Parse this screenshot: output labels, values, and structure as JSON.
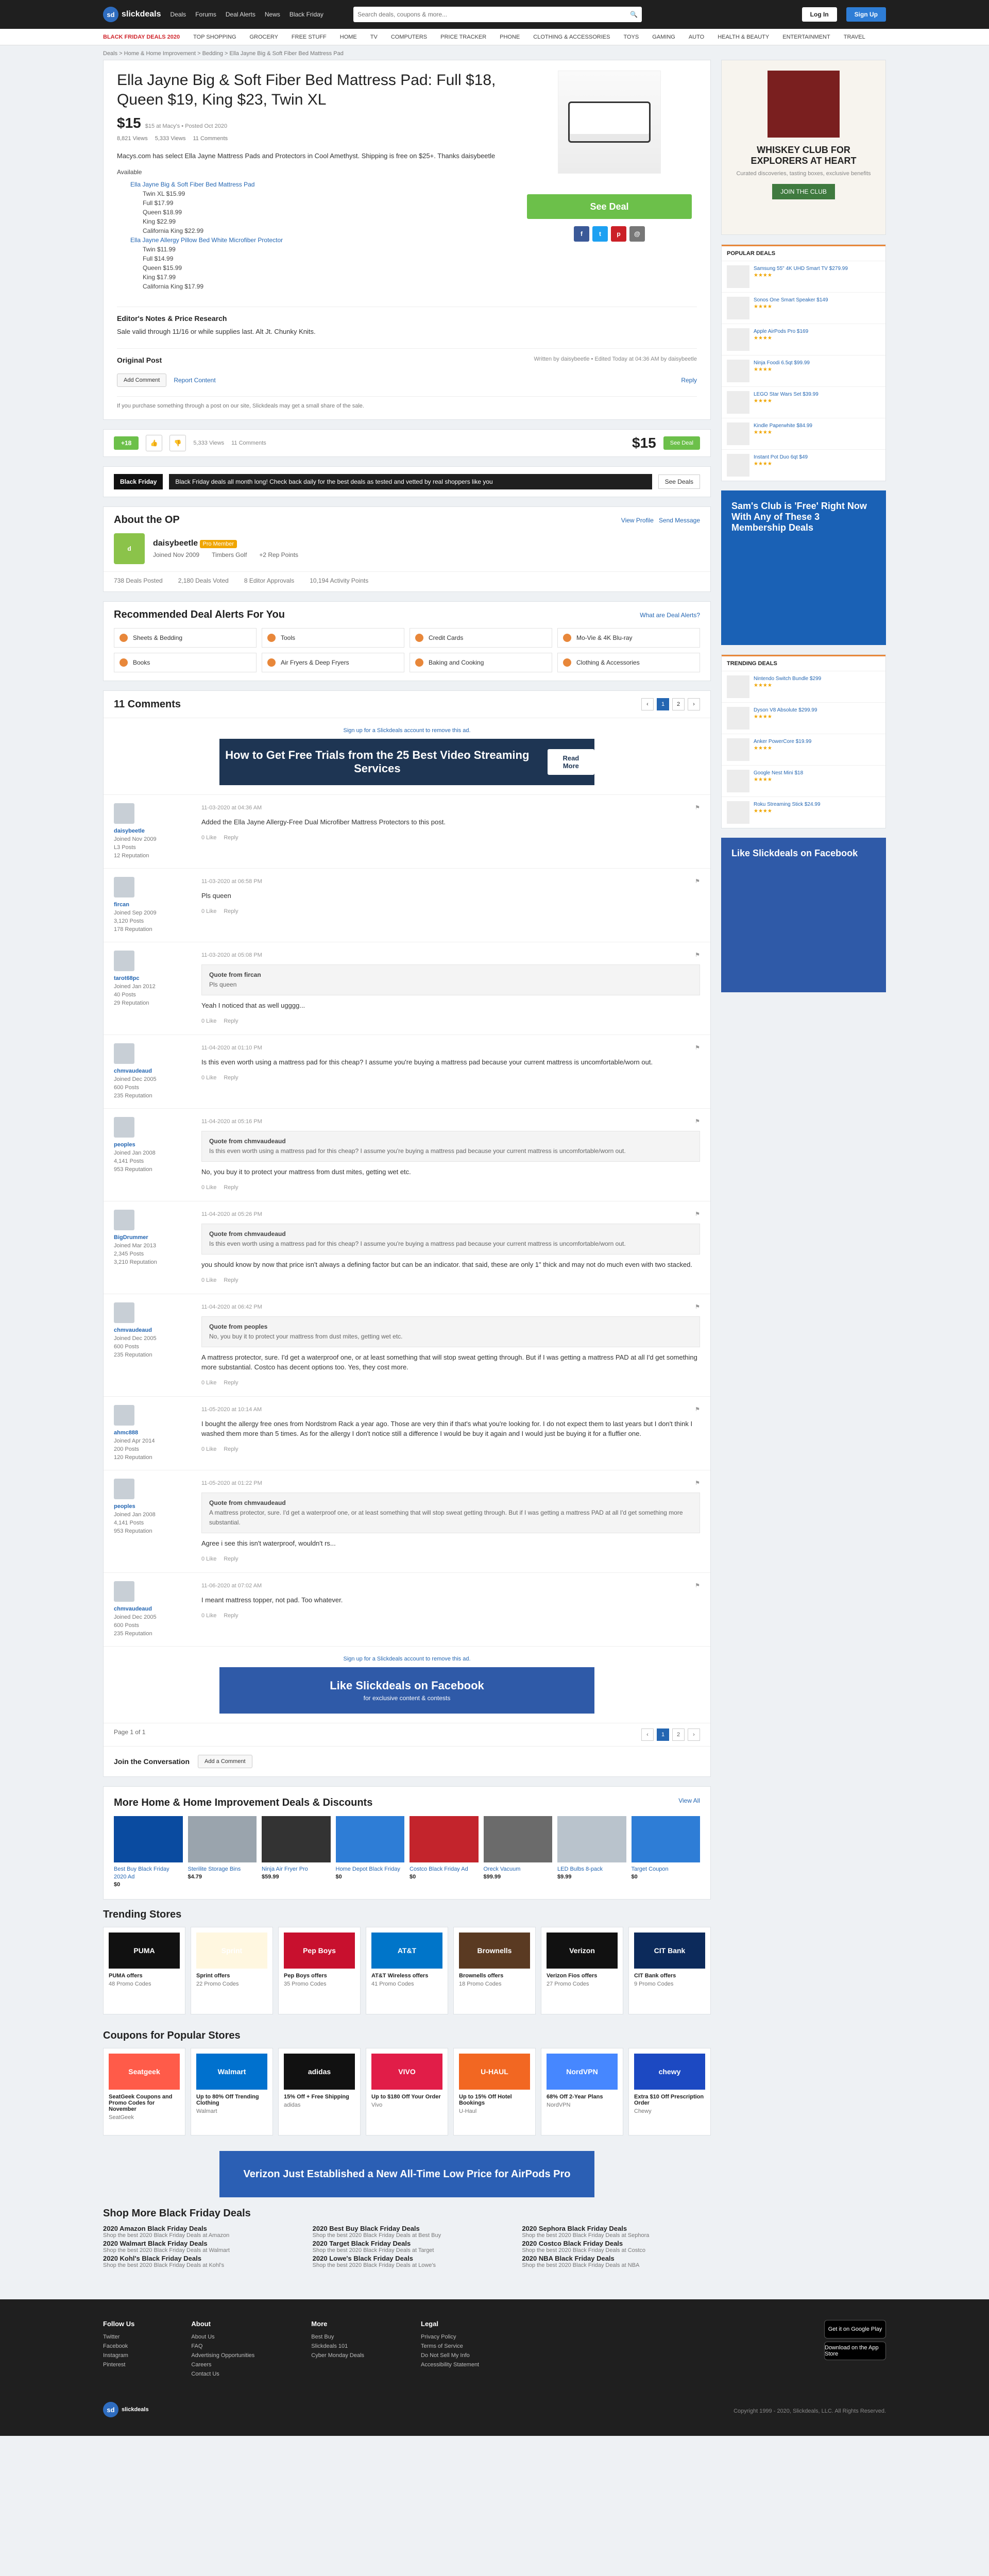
{
  "nav": {
    "logo": "slickdeals",
    "links": [
      "Deals",
      "Forums",
      "Deal Alerts",
      "News",
      "Black Friday"
    ],
    "search_placeholder": "Search deals, coupons & more...",
    "login": "Log In",
    "signup": "Sign Up"
  },
  "categories": [
    "BLACK FRIDAY DEALS 2020",
    "TOP SHOPPING",
    "GROCERY",
    "FREE STUFF",
    "HOME",
    "TV",
    "COMPUTERS",
    "PRICE TRACKER",
    "PHONE",
    "CLOTHING & ACCESSORIES",
    "TOYS",
    "GAMING",
    "AUTO",
    "HEALTH & BEAUTY",
    "ENTERTAINMENT",
    "TRAVEL"
  ],
  "breadcrumb": "Deals > Home & Home Improvement > Bedding > Ella Jayne Big & Soft Fiber Bed Mattress Pad",
  "deal": {
    "title": "Ella Jayne Big & Soft Fiber Bed Mattress Pad: Full $18, Queen $19, King $23, Twin XL",
    "price": "$15",
    "meta": "$15 at Macy's • Posted Oct 2020",
    "stats": [
      "8,821 Views",
      "5,333 Views",
      "11 Comments"
    ],
    "desc": "Macys.com has select Ella Jayne Mattress Pads and Protectors in Cool Amethyst. Shipping is free on $25+. Thanks daisybeetle",
    "available_label": "Available",
    "variants": [
      {
        "name": "Ella Jayne Big & Soft Fiber Bed Mattress Pad",
        "sizes": [
          "Twin XL $15.99",
          "Full $17.99",
          "Queen $18.99",
          "King $22.99",
          "California King $22.99"
        ]
      },
      {
        "name": "Ella Jayne Allergy Pillow Bed White Microfiber Protector",
        "sizes": [
          "Twin $11.99",
          "Full $14.99",
          "Queen $15.99",
          "King $17.99",
          "California King $17.99"
        ]
      }
    ],
    "get_deal": "See Deal",
    "editor_title": "Editor's Notes & Price Research",
    "editor_text": "Sale valid through 11/16 or while supplies last. Alt Jt. Chunky Knits.",
    "editor_by": "Written by slickdeals",
    "original_post": "Original Post",
    "original_by": "Written by daisybeetle • Edited Today at 04:36 AM by daisybeetle",
    "add_comment": "Add Comment",
    "report": "Report Content",
    "reply": "Reply",
    "notice": "If you purchase something through a post on our site, Slickdeals may get a small share of the sale."
  },
  "vote": {
    "score": "+18",
    "ratio": "5,333 Views",
    "comments": "11 Comments",
    "price": "$15",
    "cta": "See Deal"
  },
  "blackfriday": {
    "badge": "Black Friday",
    "text": "Black Friday deals all month long! Check back daily for the best deals as tested and vetted by real shoppers like you",
    "btn": "See Deals"
  },
  "op": {
    "title": "About the OP",
    "name": "daisybeetle",
    "level": "Pro Member",
    "joined": "Joined Nov 2009",
    "location": "Timbers Golf",
    "reputation": "+2 Rep Points",
    "badges": [
      "738 Deals Posted",
      "2,180 Deals Voted",
      "8 Editor Approvals",
      "10,194 Activity Points"
    ],
    "links": [
      "View Profile",
      "Send Message"
    ]
  },
  "alerts": {
    "title": "Recommended Deal Alerts For You",
    "what": "What are Deal Alerts?",
    "items": [
      "Sheets & Bedding",
      "Tools",
      "Credit Cards",
      "Mo-Vie & 4K Blu-ray",
      "Books",
      "Air Fryers & Deep Fryers",
      "Baking and Cooking",
      "Clothing & Accessories"
    ]
  },
  "comments": {
    "title": "11 Comments",
    "pages": [
      "1",
      "2"
    ],
    "signup_line": "Sign up for a Slickdeals account to remove this ad.",
    "ad1": {
      "text": "How to Get Free Trials from the 25 Best Video Streaming Services",
      "btn": "Read More"
    },
    "ad2": {
      "text": "Like Slickdeals on Facebook",
      "sub": "for exclusive content & contests"
    },
    "items": [
      {
        "user": "daisybeetle",
        "joined": "Joined Nov 2009",
        "posts": "L3 Posts",
        "rep": "12 Reputation",
        "date": "11-03-2020 at 04:36 AM",
        "quote_by": "",
        "quote": "",
        "body": "Added the Ella Jayne Allergy-Free Dual Microfiber Mattress Protectors to this post.",
        "likes": "0 Like"
      },
      {
        "user": "fircan",
        "joined": "Joined Sep 2009",
        "posts": "3,120 Posts",
        "rep": "178 Reputation",
        "date": "11-03-2020 at 06:58 PM",
        "quote_by": "",
        "quote": "",
        "body": "Pls queen",
        "likes": "0 Like"
      },
      {
        "user": "tarot68pc",
        "joined": "Joined Jan 2012",
        "posts": "40 Posts",
        "rep": "29 Reputation",
        "date": "11-03-2020 at 05:08 PM",
        "quote_by": "Quote from fircan",
        "quote": "Pls queen",
        "body": "Yeah I noticed that as well ugggg...",
        "likes": "0 Like"
      },
      {
        "user": "chmvaudeaud",
        "joined": "Joined Dec 2005",
        "posts": "600 Posts",
        "rep": "235 Reputation",
        "date": "11-04-2020 at 01:10 PM",
        "quote_by": "",
        "quote": "",
        "body": "Is this even worth using a mattress pad for this cheap? I assume you're buying a mattress pad because your current mattress is uncomfortable/worn out.",
        "likes": "0 Like"
      },
      {
        "user": "peoples",
        "joined": "Joined Jan 2008",
        "posts": "4,141 Posts",
        "rep": "953 Reputation",
        "date": "11-04-2020 at 05:16 PM",
        "quote_by": "Quote from chmvaudeaud",
        "quote": "Is this even worth using a mattress pad for this cheap? I assume you're buying a mattress pad because your current mattress is uncomfortable/worn out.",
        "body": "No, you buy it to protect your mattress from dust mites, getting wet etc.",
        "likes": "0 Like"
      },
      {
        "user": "BigDrummer",
        "joined": "Joined Mar 2013",
        "posts": "2,345 Posts",
        "rep": "3,210 Reputation",
        "date": "11-04-2020 at 05:26 PM",
        "quote_by": "Quote from chmvaudeaud",
        "quote": "Is this even worth using a mattress pad for this cheap? I assume you're buying a mattress pad because your current mattress is uncomfortable/worn out.",
        "body": "you should know by now that price isn't always a defining factor but can be an indicator. that said, these are only 1\" thick and may not do much even with two stacked.",
        "likes": "0 Like"
      },
      {
        "user": "chmvaudeaud",
        "joined": "Joined Dec 2005",
        "posts": "600 Posts",
        "rep": "235 Reputation",
        "date": "11-04-2020 at 06:42 PM",
        "quote_by": "Quote from peoples",
        "quote": "No, you buy it to protect your mattress from dust mites, getting wet etc.",
        "body": "A mattress protector, sure. I'd get a waterproof one, or at least something that will stop sweat getting through. But if I was getting a mattress PAD at all I'd get something more substantial. Costco has decent options too. Yes, they cost more.",
        "likes": "0 Like"
      },
      {
        "user": "ahmc888",
        "joined": "Joined Apr 2014",
        "posts": "200 Posts",
        "rep": "120 Reputation",
        "date": "11-05-2020 at 10:14 AM",
        "quote_by": "",
        "quote": "",
        "body": "I bought the allergy free ones from Nordstrom Rack a year ago. Those are very thin if that's what you're looking for. I do not expect them to last years but I don't think I washed them more than 5 times. As for the allergy I don't notice still a difference I would be buy it again and I would just be buying it for a fluffier one.",
        "likes": "0 Like"
      },
      {
        "user": "peoples",
        "joined": "Joined Jan 2008",
        "posts": "4,141 Posts",
        "rep": "953 Reputation",
        "date": "11-05-2020 at 01:22 PM",
        "quote_by": "Quote from chmvaudeaud",
        "quote": "A mattress protector, sure. I'd get a waterproof one, or at least something that will stop sweat getting through. But if I was getting a mattress PAD at all I'd get something more substantial.",
        "body": "Agree i see this isn't waterproof, wouldn't rs...",
        "likes": "0 Like"
      },
      {
        "user": "chmvaudeaud",
        "joined": "Joined Dec 2005",
        "posts": "600 Posts",
        "rep": "235 Reputation",
        "date": "11-06-2020 at 07:02 AM",
        "quote_by": "",
        "quote": "",
        "body": "I meant mattress topper, not pad. Too whatever.",
        "likes": "0 Like"
      }
    ],
    "page_label": "Page 1 of 1",
    "join": "Join the Conversation",
    "add_comment": "Add a Comment"
  },
  "more_deals": {
    "title": "More Home & Home Improvement Deals & Discounts",
    "view_all": "View All",
    "items": [
      {
        "name": "Best Buy Black Friday 2020 Ad",
        "price": "$0",
        "color": "#0a4ba0"
      },
      {
        "name": "Sterilite Storage Bins",
        "price": "$4.79",
        "color": "#9aa4ad"
      },
      {
        "name": "Ninja Air Fryer Pro",
        "price": "$59.99",
        "color": "#333"
      },
      {
        "name": "Home Depot Black Friday",
        "price": "$0",
        "color": "#2e7dd6"
      },
      {
        "name": "Costco Black Friday Ad",
        "price": "$0",
        "color": "#c3242c"
      },
      {
        "name": "Oreck Vacuum",
        "price": "$99.99",
        "color": "#6b6b6b"
      },
      {
        "name": "LED Bulbs 8-pack",
        "price": "$9.99",
        "color": "#b9c3cc"
      },
      {
        "name": "Target Coupon",
        "price": "$0",
        "color": "#2e7dd6"
      }
    ]
  },
  "stores": {
    "title": "Trending Stores",
    "items": [
      {
        "name": "PUMA",
        "offer": "PUMA offers",
        "sub": "48 Promo Codes"
      },
      {
        "name": "Sprint",
        "offer": "Sprint offers",
        "sub": "22 Promo Codes"
      },
      {
        "name": "Pep Boys",
        "offer": "Pep Boys offers",
        "sub": "35 Promo Codes"
      },
      {
        "name": "AT&T",
        "offer": "AT&T Wireless offers",
        "sub": "41 Promo Codes"
      },
      {
        "name": "Brownells",
        "offer": "Brownells offers",
        "sub": "18 Promo Codes"
      },
      {
        "name": "Verizon",
        "offer": "Verizon Fios offers",
        "sub": "27 Promo Codes"
      },
      {
        "name": "CIT Bank",
        "offer": "CIT Bank offers",
        "sub": "9 Promo Codes"
      }
    ]
  },
  "coupons": {
    "title": "Coupons for Popular Stores",
    "items": [
      {
        "name": "Seatgeek",
        "offer": "SeatGeek Coupons and Promo Codes for November",
        "sub": "SeatGeek"
      },
      {
        "name": "Walmart",
        "offer": "Up to 80% Off Trending Clothing",
        "sub": "Walmart"
      },
      {
        "name": "adidas",
        "offer": "15% Off + Free Shipping",
        "sub": "adidas"
      },
      {
        "name": "VIVO",
        "offer": "Up to $180 Off Your Order",
        "sub": "Vivo"
      },
      {
        "name": "U-HAUL",
        "offer": "Up to 15% Off Hotel Bookings",
        "sub": "U-Haul"
      },
      {
        "name": "NordVPN",
        "offer": "68% Off 2-Year Plans",
        "sub": "NordVPN"
      },
      {
        "name": "chewy",
        "offer": "Extra $10 Off Prescription Order",
        "sub": "Chewy"
      }
    ]
  },
  "ad_bottom": "Verizon Just Established a New All-Time Low Price for AirPods Pro",
  "shopmore": {
    "title": "Shop More Black Friday Deals",
    "items": [
      {
        "d": "2020 Amazon Black Friday Deals",
        "s": "Shop the best 2020 Black Friday Deals at Amazon"
      },
      {
        "d": "2020 Best Buy Black Friday Deals",
        "s": "Shop the best 2020 Black Friday Deals at Best Buy"
      },
      {
        "d": "2020 Sephora Black Friday Deals",
        "s": "Shop the best 2020 Black Friday Deals at Sephora"
      },
      {
        "d": "2020 Walmart Black Friday Deals",
        "s": "Shop the best 2020 Black Friday Deals at Walmart"
      },
      {
        "d": "2020 Target Black Friday Deals",
        "s": "Shop the best 2020 Black Friday Deals at Target"
      },
      {
        "d": "2020 Costco Black Friday Deals",
        "s": "Shop the best 2020 Black Friday Deals at Costco"
      },
      {
        "d": "2020 Kohl's Black Friday Deals",
        "s": "Shop the best 2020 Black Friday Deals at Kohl's"
      },
      {
        "d": "2020 Lowe's Black Friday Deals",
        "s": "Shop the best 2020 Black Friday Deals at Lowe's"
      },
      {
        "d": "2020 NBA Black Friday Deals",
        "s": "Shop the best 2020 Black Friday Deals at NBA"
      }
    ]
  },
  "sidebar": {
    "ad1": {
      "title": "WHISKEY CLUB FOR EXPLORERS AT HEART",
      "sub": "Curated discoveries, tasting boxes, exclusive benefits",
      "btn": "JOIN THE CLUB"
    },
    "popular_title": "POPULAR DEALS",
    "popular": [
      "Samsung 55\" 4K UHD Smart TV $279.99",
      "Sonos One Smart Speaker $149",
      "Apple AirPods Pro $169",
      "Ninja Foodi 6.5qt $99.99",
      "LEGO Star Wars Set $39.99",
      "Kindle Paperwhite $84.99",
      "Instant Pot Duo 6qt $49"
    ],
    "ad2": "Sam's Club is 'Free' Right Now With Any of These 3 Membership Deals",
    "trending_title": "TRENDING DEALS",
    "trending": [
      "Nintendo Switch Bundle $299",
      "Dyson V8 Absolute $299.99",
      "Anker PowerCore $19.99",
      "Google Nest Mini $18",
      "Roku Streaming Stick $24.99"
    ],
    "ad3": "Like Slickdeals on Facebook"
  },
  "footer": {
    "cols": [
      {
        "h": "Follow Us",
        "items": [
          "Twitter",
          "Facebook",
          "Instagram",
          "Pinterest"
        ]
      },
      {
        "h": "About",
        "items": [
          "About Us",
          "FAQ",
          "Advertising Opportunities",
          "Careers",
          "Contact Us"
        ]
      },
      {
        "h": "More",
        "items": [
          "Best Buy",
          "Slickdeals 101",
          "Cyber Monday Deals"
        ]
      },
      {
        "h": "Legal",
        "items": [
          "Privacy Policy",
          "Terms of Service",
          "Do Not Sell My Info",
          "Accessibility Statement"
        ]
      }
    ],
    "apps": [
      "Get it on Google Play",
      "Download on the App Store"
    ],
    "copyright": "Copyright 1999 - 2020, Slickdeals, LLC. All Rights Reserved."
  }
}
